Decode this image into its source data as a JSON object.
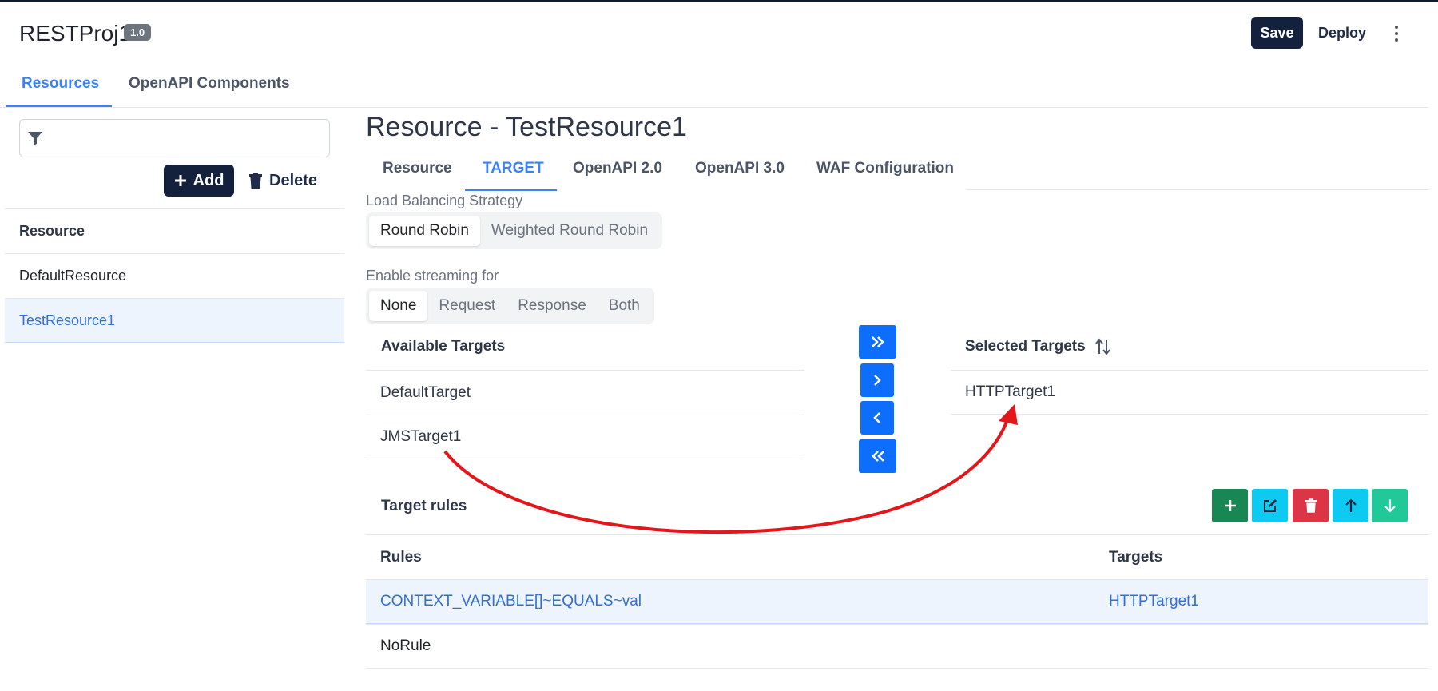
{
  "header": {
    "project_name": "RESTProj1",
    "version": "1.0",
    "save_label": "Save",
    "deploy_label": "Deploy",
    "more_icon": "kebab-vertical-icon"
  },
  "top_tabs": [
    {
      "label": "Resources",
      "active": true
    },
    {
      "label": "OpenAPI Components",
      "active": false
    }
  ],
  "sidebar": {
    "filter_placeholder": "",
    "filter_icon": "filter-icon",
    "add_label": "Add",
    "delete_label": "Delete",
    "column_header": "Resource",
    "items": [
      {
        "label": "DefaultResource",
        "selected": false
      },
      {
        "label": "TestResource1",
        "selected": true
      }
    ]
  },
  "main": {
    "title": "Resource - TestResource1",
    "tabs": [
      {
        "label": "Resource",
        "active": false
      },
      {
        "label": "TARGET",
        "active": true
      },
      {
        "label": "OpenAPI 2.0",
        "active": false
      },
      {
        "label": "OpenAPI 3.0",
        "active": false
      },
      {
        "label": "WAF Configuration",
        "active": false
      }
    ],
    "load_balancing": {
      "label": "Load Balancing Strategy",
      "options": [
        "Round Robin",
        "Weighted Round Robin"
      ],
      "selected": "Round Robin"
    },
    "streaming": {
      "label": "Enable streaming for",
      "options": [
        "None",
        "Request",
        "Response",
        "Both"
      ],
      "selected": "None"
    },
    "available_targets": {
      "header": "Available Targets",
      "items": [
        "DefaultTarget",
        "JMSTarget1"
      ]
    },
    "selected_targets": {
      "header": "Selected Targets",
      "sort_icon": "sort-arrows-icon",
      "items": [
        "HTTPTarget1"
      ]
    },
    "move_buttons": [
      "move-all-right-icon",
      "move-right-icon",
      "move-left-icon",
      "move-all-left-icon"
    ],
    "target_rules": {
      "title": "Target rules",
      "buttons": [
        {
          "name": "add-rule",
          "icon": "plus-icon",
          "color": "#198754"
        },
        {
          "name": "edit-rule",
          "icon": "edit-icon",
          "color": "#0dcaf0"
        },
        {
          "name": "delete-rule",
          "icon": "trash-icon",
          "color": "#dc3545"
        },
        {
          "name": "move-rule-up",
          "icon": "arrow-up-icon",
          "color": "#0dcaf0"
        },
        {
          "name": "move-rule-down",
          "icon": "arrow-down-icon",
          "color": "#20c997"
        }
      ],
      "columns": [
        "Rules",
        "Targets"
      ],
      "rows": [
        {
          "rule": "CONTEXT_VARIABLE[]~EQUALS~val",
          "target": "HTTPTarget1",
          "selected": true
        },
        {
          "rule": "NoRule",
          "target": "",
          "selected": false
        }
      ]
    }
  },
  "annotation": {
    "color": "#e3161b"
  }
}
